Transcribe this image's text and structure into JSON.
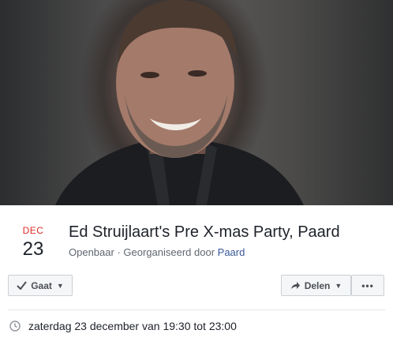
{
  "event": {
    "month": "DEC",
    "day": "23",
    "title": "Ed Struijlaart's Pre X-mas Party, Paard",
    "privacy": "Openbaar",
    "organizer_prefix": "· Georganiseerd door",
    "organizer": "Paard",
    "datetime": "zaterdag 23 december van 19:30 tot 23:00"
  },
  "actions": {
    "going_label": "Gaat",
    "share_label": "Delen",
    "more_label": "•••"
  },
  "icons": [
    "cover-photo",
    "check-icon",
    "share-arrow-icon",
    "clock-icon"
  ],
  "colors": {
    "month": "#e02b2b",
    "link": "#385898",
    "meta": "#606770"
  }
}
